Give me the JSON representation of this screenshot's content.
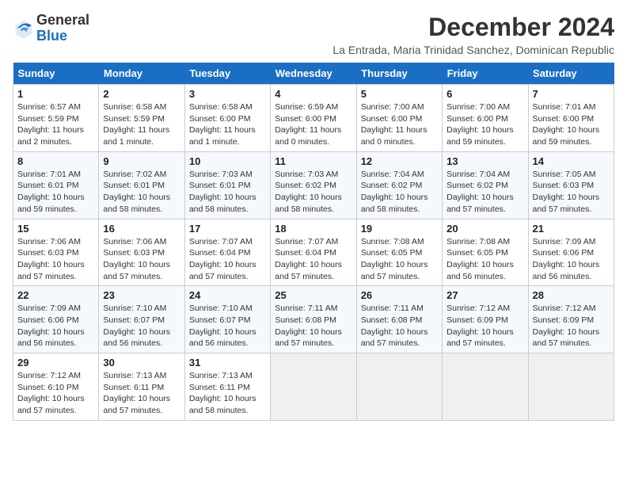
{
  "header": {
    "logo_general": "General",
    "logo_blue": "Blue",
    "month_title": "December 2024",
    "location": "La Entrada, Maria Trinidad Sanchez, Dominican Republic"
  },
  "weekdays": [
    "Sunday",
    "Monday",
    "Tuesday",
    "Wednesday",
    "Thursday",
    "Friday",
    "Saturday"
  ],
  "weeks": [
    [
      {
        "day": "1",
        "sunrise": "6:57 AM",
        "sunset": "5:59 PM",
        "daylight": "11 hours and 2 minutes."
      },
      {
        "day": "2",
        "sunrise": "6:58 AM",
        "sunset": "5:59 PM",
        "daylight": "11 hours and 1 minute."
      },
      {
        "day": "3",
        "sunrise": "6:58 AM",
        "sunset": "6:00 PM",
        "daylight": "11 hours and 1 minute."
      },
      {
        "day": "4",
        "sunrise": "6:59 AM",
        "sunset": "6:00 PM",
        "daylight": "11 hours and 0 minutes."
      },
      {
        "day": "5",
        "sunrise": "7:00 AM",
        "sunset": "6:00 PM",
        "daylight": "11 hours and 0 minutes."
      },
      {
        "day": "6",
        "sunrise": "7:00 AM",
        "sunset": "6:00 PM",
        "daylight": "10 hours and 59 minutes."
      },
      {
        "day": "7",
        "sunrise": "7:01 AM",
        "sunset": "6:00 PM",
        "daylight": "10 hours and 59 minutes."
      }
    ],
    [
      {
        "day": "8",
        "sunrise": "7:01 AM",
        "sunset": "6:01 PM",
        "daylight": "10 hours and 59 minutes."
      },
      {
        "day": "9",
        "sunrise": "7:02 AM",
        "sunset": "6:01 PM",
        "daylight": "10 hours and 58 minutes."
      },
      {
        "day": "10",
        "sunrise": "7:03 AM",
        "sunset": "6:01 PM",
        "daylight": "10 hours and 58 minutes."
      },
      {
        "day": "11",
        "sunrise": "7:03 AM",
        "sunset": "6:02 PM",
        "daylight": "10 hours and 58 minutes."
      },
      {
        "day": "12",
        "sunrise": "7:04 AM",
        "sunset": "6:02 PM",
        "daylight": "10 hours and 58 minutes."
      },
      {
        "day": "13",
        "sunrise": "7:04 AM",
        "sunset": "6:02 PM",
        "daylight": "10 hours and 57 minutes."
      },
      {
        "day": "14",
        "sunrise": "7:05 AM",
        "sunset": "6:03 PM",
        "daylight": "10 hours and 57 minutes."
      }
    ],
    [
      {
        "day": "15",
        "sunrise": "7:06 AM",
        "sunset": "6:03 PM",
        "daylight": "10 hours and 57 minutes."
      },
      {
        "day": "16",
        "sunrise": "7:06 AM",
        "sunset": "6:03 PM",
        "daylight": "10 hours and 57 minutes."
      },
      {
        "day": "17",
        "sunrise": "7:07 AM",
        "sunset": "6:04 PM",
        "daylight": "10 hours and 57 minutes."
      },
      {
        "day": "18",
        "sunrise": "7:07 AM",
        "sunset": "6:04 PM",
        "daylight": "10 hours and 57 minutes."
      },
      {
        "day": "19",
        "sunrise": "7:08 AM",
        "sunset": "6:05 PM",
        "daylight": "10 hours and 57 minutes."
      },
      {
        "day": "20",
        "sunrise": "7:08 AM",
        "sunset": "6:05 PM",
        "daylight": "10 hours and 56 minutes."
      },
      {
        "day": "21",
        "sunrise": "7:09 AM",
        "sunset": "6:06 PM",
        "daylight": "10 hours and 56 minutes."
      }
    ],
    [
      {
        "day": "22",
        "sunrise": "7:09 AM",
        "sunset": "6:06 PM",
        "daylight": "10 hours and 56 minutes."
      },
      {
        "day": "23",
        "sunrise": "7:10 AM",
        "sunset": "6:07 PM",
        "daylight": "10 hours and 56 minutes."
      },
      {
        "day": "24",
        "sunrise": "7:10 AM",
        "sunset": "6:07 PM",
        "daylight": "10 hours and 56 minutes."
      },
      {
        "day": "25",
        "sunrise": "7:11 AM",
        "sunset": "6:08 PM",
        "daylight": "10 hours and 57 minutes."
      },
      {
        "day": "26",
        "sunrise": "7:11 AM",
        "sunset": "6:08 PM",
        "daylight": "10 hours and 57 minutes."
      },
      {
        "day": "27",
        "sunrise": "7:12 AM",
        "sunset": "6:09 PM",
        "daylight": "10 hours and 57 minutes."
      },
      {
        "day": "28",
        "sunrise": "7:12 AM",
        "sunset": "6:09 PM",
        "daylight": "10 hours and 57 minutes."
      }
    ],
    [
      {
        "day": "29",
        "sunrise": "7:12 AM",
        "sunset": "6:10 PM",
        "daylight": "10 hours and 57 minutes."
      },
      {
        "day": "30",
        "sunrise": "7:13 AM",
        "sunset": "6:11 PM",
        "daylight": "10 hours and 57 minutes."
      },
      {
        "day": "31",
        "sunrise": "7:13 AM",
        "sunset": "6:11 PM",
        "daylight": "10 hours and 58 minutes."
      },
      null,
      null,
      null,
      null
    ]
  ]
}
